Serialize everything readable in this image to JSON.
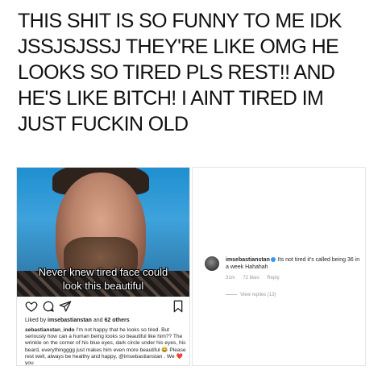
{
  "headline": [
    "THIS SHIT IS SO FUNNY TO ME IDK",
    "JSSJSJSSJ THEY'RE LIKE OMG HE",
    "LOOKS SO TIRED PLS REST!! AND",
    "HE'S LIKE BITCH! I AINT TIRED IM",
    "JUST FUCKIN OLD"
  ],
  "left_post": {
    "caption_line1": "Never knew tired face could",
    "caption_line2": "look this beautiful",
    "icons": [
      "heart-icon",
      "comment-icon",
      "send-icon",
      "bookmark-icon"
    ],
    "liked_prefix": "Liked by ",
    "liked_user": "imsebastianstan",
    "liked_mid": " and ",
    "liked_count": "62 others",
    "comment_user": "sebastianstan_indo",
    "comment_text": " I'm not happy that he looks so tired. But seriously how can a human being looks so beautiful like him?? The wrinkle on the corner of his blue eyes, dark circle under his eyes, his beard, everythingggg just makes him even more beautiful 😂 Please rest well, always be healthy and happy, @imsebastianstan . We ❤️ you"
  },
  "right_post": {
    "username": "imsebastianstan",
    "reply_text": " Its not tired it's called being 36 in a week Hahahah",
    "time": "31m",
    "likes": "72 likes",
    "reply_label": "Reply",
    "view_replies": "View replies (13)"
  }
}
